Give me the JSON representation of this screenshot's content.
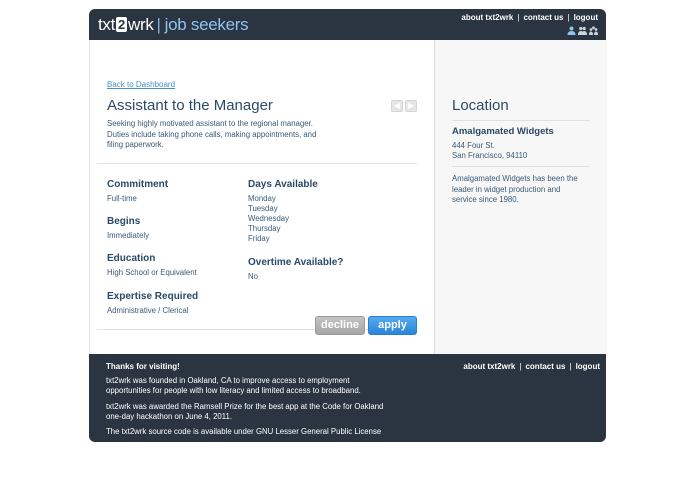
{
  "header": {
    "logo_text_left": "txt",
    "logo_badge": "2",
    "logo_text_right": "wrk",
    "logo_separator": "|",
    "logo_subtitle": "job seekers",
    "nav": [
      {
        "label": "about txt2wrk"
      },
      {
        "label": "contact us"
      },
      {
        "label": "logout"
      }
    ],
    "nav_separator": "|",
    "user_icons": [
      "single-user-icon",
      "two-users-icon",
      "group-users-icon"
    ]
  },
  "main": {
    "back_link": "Back to Dashboard",
    "job_title": "Assistant to the Manager",
    "description": "Seeking highly motivated assistant to the regional manager. Duties include taking phone calls, making appointments, and filing paperwork.",
    "prev_icon": "chevron-left-icon",
    "next_icon": "chevron-right-icon",
    "prev_glyph": "◀",
    "next_glyph": "▶",
    "fields_left": [
      {
        "label": "Commitment",
        "value": "Full-time"
      },
      {
        "label": "Begins",
        "value": "Immediately"
      },
      {
        "label": "Education",
        "value": "High School or Equivalent"
      },
      {
        "label": "Expertise Required",
        "value": "Administrative / Clerical"
      }
    ],
    "days_label": "Days Available",
    "days": [
      "Monday",
      "Tuesday",
      "Wednesday",
      "Thursday",
      "Friday"
    ],
    "overtime_label": "Overtime Available?",
    "overtime_value": "No",
    "decline_label": "decline",
    "apply_label": "apply"
  },
  "sidebar": {
    "title": "Location",
    "company": "Amalgamated Widgets",
    "address_line1": "444 Four St.",
    "address_line2": "San Francisco, 94110",
    "about": "Amalgamated Widgets has been the leader in widget production and service since 1980."
  },
  "footer": {
    "thanks": "Thanks for visiting!",
    "nav": [
      {
        "label": "about txt2wrk"
      },
      {
        "label": "contact us"
      },
      {
        "label": "logout"
      }
    ],
    "nav_separator": "|",
    "paragraph1": "txt2wrk was founded in Oakland, CA to improve access to employment opportunities for people with low literacy and limited access to broadband.",
    "paragraph2": "txt2wrk was awarded the Ramsell Prize for the best app at the Code for Oakland one-day hackathon on June 4, 2011.",
    "paragraph3": "The txt2wrk source code is available under GNU Lesser General Public License"
  },
  "colors": {
    "header_bg": "#2a3541",
    "accent_blue": "#2a86da",
    "heading_text": "#2b4a66",
    "sidebar_bg": "#f7f7f7"
  }
}
